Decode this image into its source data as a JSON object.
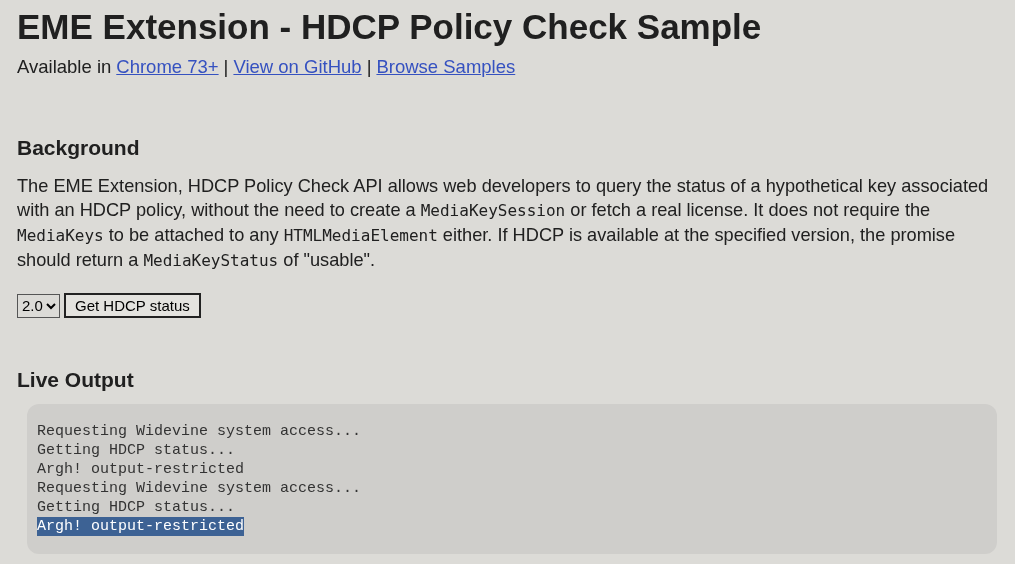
{
  "title": "EME Extension - HDCP Policy Check Sample",
  "availability": {
    "prefix": "Available in",
    "separator": "|",
    "links": [
      "Chrome 73+",
      "View on GitHub",
      "Browse Samples"
    ]
  },
  "background": {
    "heading": "Background",
    "paragraph": [
      {
        "kind": "text",
        "text": "The EME Extension, HDCP Policy Check API allows web developers to query the status of a hypothetical key associated with an HDCP policy, without the need to create a "
      },
      {
        "kind": "code",
        "text": "MediaKeySession"
      },
      {
        "kind": "text",
        "text": " or fetch a real license. It does not require the "
      },
      {
        "kind": "code",
        "text": "MediaKeys"
      },
      {
        "kind": "text",
        "text": " to be attached to any "
      },
      {
        "kind": "code",
        "text": "HTMLMediaElement"
      },
      {
        "kind": "text",
        "text": " either. If HDCP is available at the specified version, the promise should return a "
      },
      {
        "kind": "code",
        "text": "MediaKeyStatus"
      },
      {
        "kind": "text",
        "text": " of \"usable\"."
      }
    ]
  },
  "controls": {
    "version_select": {
      "value": "2.0"
    },
    "button": "Get HDCP status"
  },
  "live_output": {
    "heading": "Live Output",
    "lines": [
      {
        "text": "Requesting Widevine system access...",
        "selected": false
      },
      {
        "text": "Getting HDCP status...",
        "selected": false
      },
      {
        "text": "Argh! output-restricted",
        "selected": false
      },
      {
        "text": "Requesting Widevine system access...",
        "selected": false
      },
      {
        "text": "Getting HDCP status...",
        "selected": false
      },
      {
        "text": "Argh! output-restricted",
        "selected": true
      }
    ]
  }
}
